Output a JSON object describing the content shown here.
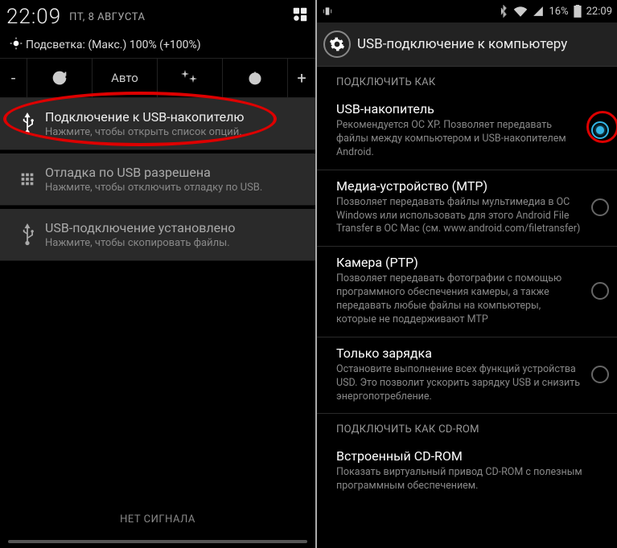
{
  "left": {
    "status": {
      "time": "22:09",
      "date": "ПТ, 8 АВГУСТА"
    },
    "brightness_label": "Подсветка: (Макс.) 100% (+100%)",
    "toolbar": {
      "minus": "-",
      "auto": "Авто",
      "plus": "+"
    },
    "notifications": [
      {
        "title": "Подключение к USB-накопителю",
        "sub": "Нажмите, чтобы открыть список опций."
      },
      {
        "title": "Отладка по USB разрешена",
        "sub": "Нажмите, чтобы отключить отладку по USB."
      },
      {
        "title": "USB-подключение установлено",
        "sub": "Нажмите, чтобы скопировать файлы."
      }
    ],
    "no_signal": "НЕТ СИГНАЛА"
  },
  "right": {
    "status": {
      "battery": "16%",
      "time": "22:09"
    },
    "header_title": "USB-подключение к компьютеру",
    "section1": "ПОДКЛЮЧИТЬ КАК",
    "options": [
      {
        "title": "USB-накопитель",
        "desc": "Рекомендуется ОС XP. Позволяет передавать файлы между компьютером и USB-накопителем Android.",
        "selected": true
      },
      {
        "title": "Медиа-устройство (MTP)",
        "desc": "Позволяет передавать файлы мультимедиа в ОС Windows или использовать для этого Android File Transfer в ОС Mac (см. www.android.com/filetransfer)",
        "selected": false
      },
      {
        "title": "Камера (PTP)",
        "desc": "Позволяет передавать фотографии с помощью программного обеспечения камеры, а также передавать любые файлы на компьютеры, которые не поддерживают MTP",
        "selected": false
      },
      {
        "title": "Только зарядка",
        "desc": "Остановите выполнение всех функций устройства USD. Это позволит ускорить зарядку USB и снизить энергопотребление.",
        "selected": false
      }
    ],
    "section2": "ПОДКЛЮЧИТЬ КАК CD-ROM",
    "cdrom": {
      "title": "Встроенный CD-ROM",
      "desc": "Показать виртуальный привод CD-ROM с полезным программным обеспечением."
    }
  }
}
